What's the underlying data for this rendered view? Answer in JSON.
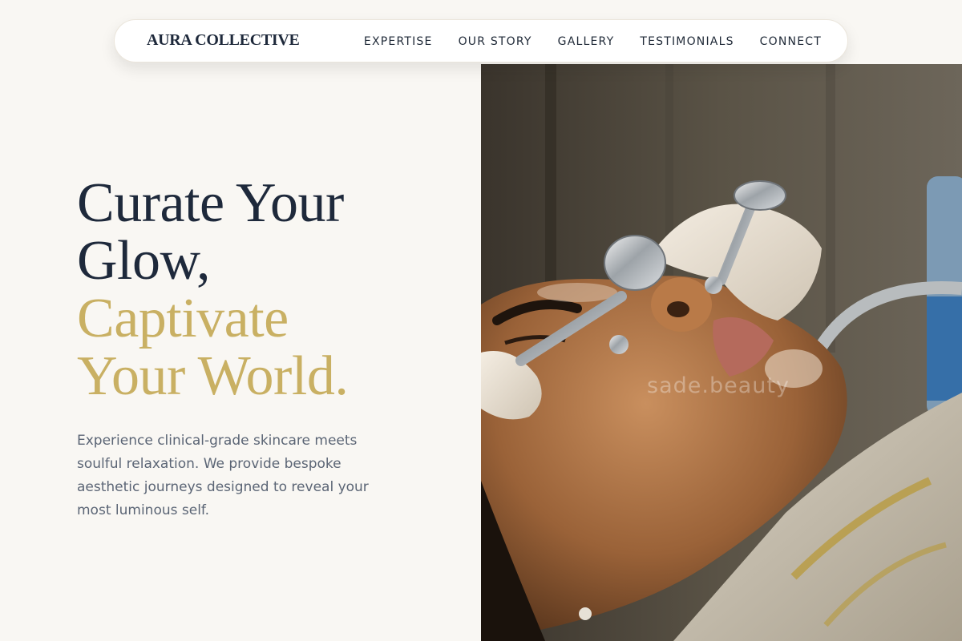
{
  "brand": {
    "name": "AURA COLLECTIVE"
  },
  "nav": {
    "links": [
      "EXPERTISE",
      "OUR STORY",
      "GALLERY",
      "TESTIMONIALS",
      "CONNECT"
    ]
  },
  "hero": {
    "headline_line1": "Curate Your",
    "headline_line2": "Glow,",
    "headline_line3": "Captivate",
    "headline_line4": "Your World.",
    "description": "Experience clinical-grade skincare meets soulful relaxation. We provide bespoke aesthetic journeys designed to reveal your most luminous self."
  },
  "image": {
    "watermark": "sade.beauty"
  },
  "colors": {
    "background": "#f9f7f3",
    "navy": "#1e293b",
    "gold": "#c9b063",
    "body_text": "#5b6575"
  }
}
